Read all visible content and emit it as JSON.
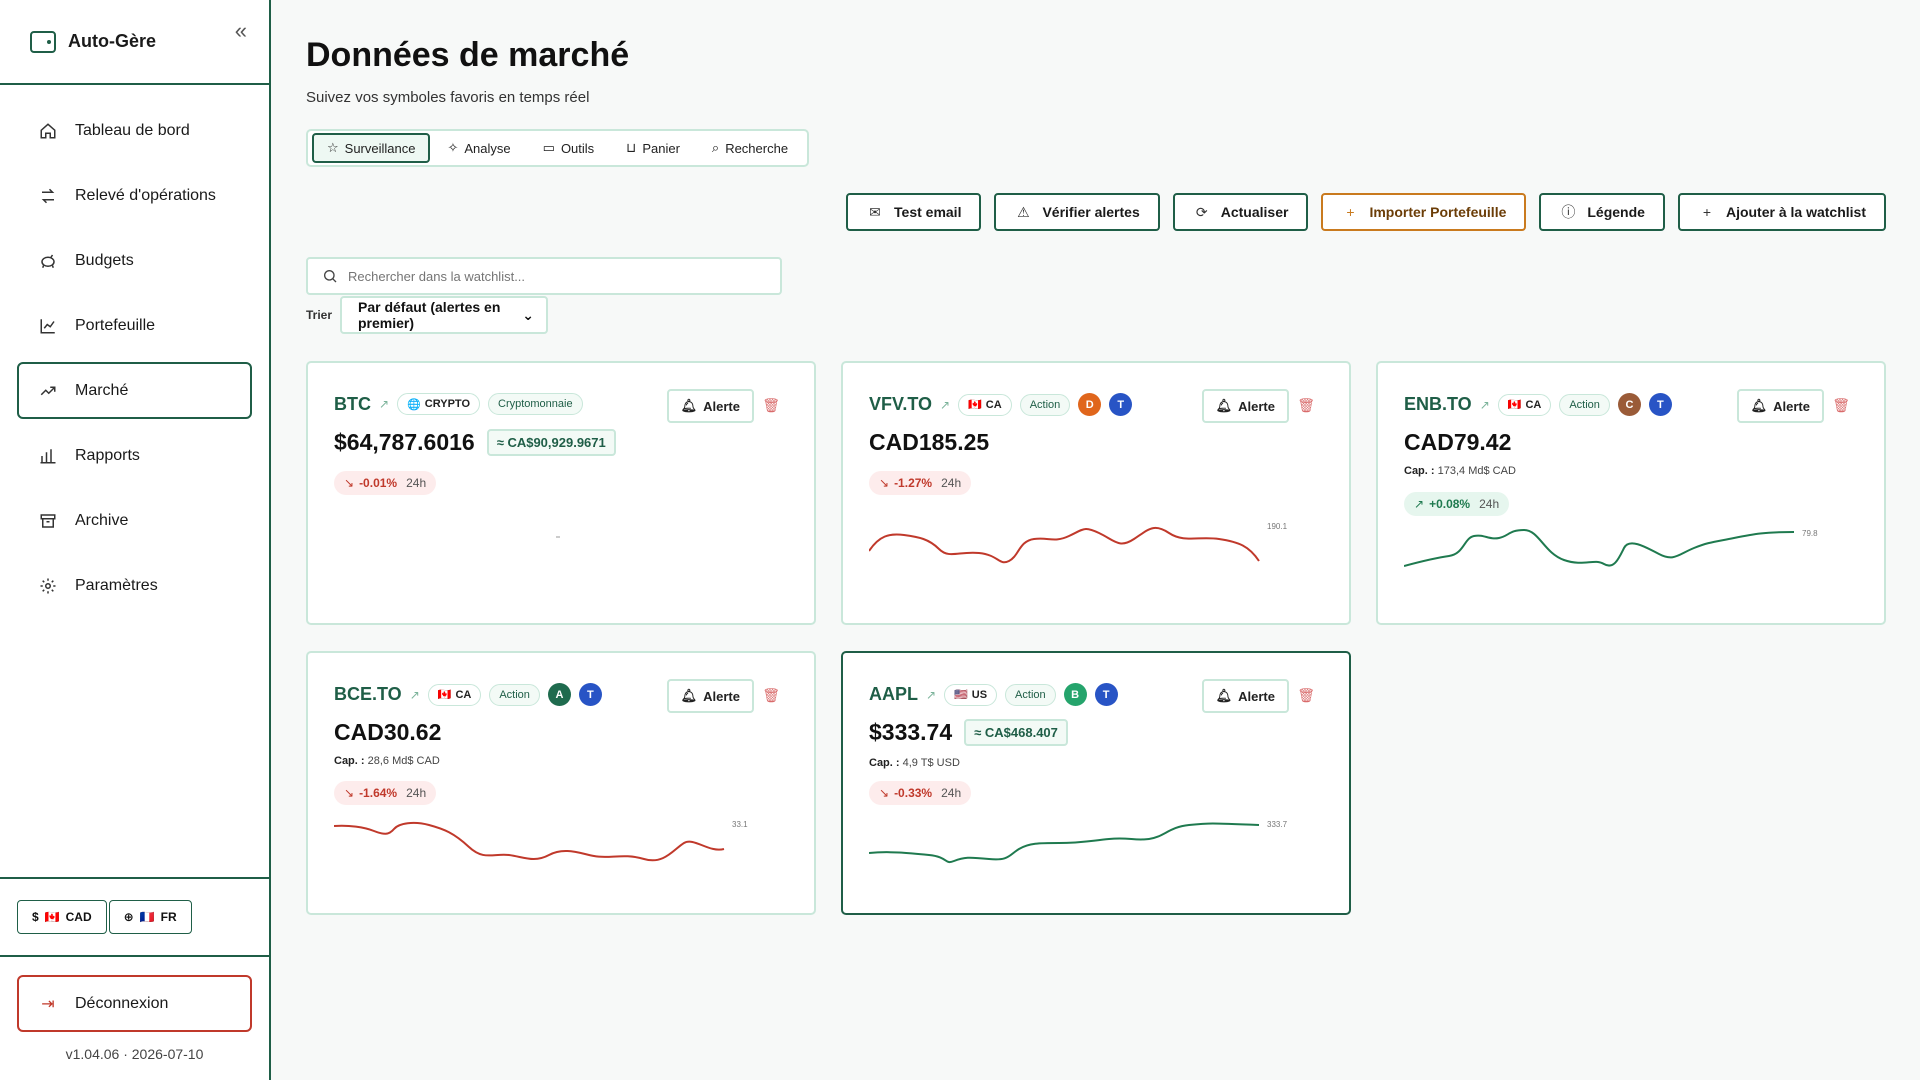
{
  "app": {
    "name": "Auto-Gère",
    "version": "v1.04.06 · 2026-07-10"
  },
  "sidebar": {
    "items": [
      {
        "label": "Tableau de bord",
        "icon": "home-icon"
      },
      {
        "label": "Relevé d'opérations",
        "icon": "transfer-icon"
      },
      {
        "label": "Budgets",
        "icon": "piggy-bank-icon"
      },
      {
        "label": "Portefeuille",
        "icon": "line-chart-icon"
      },
      {
        "label": "Marché",
        "icon": "trending-up-icon"
      },
      {
        "label": "Rapports",
        "icon": "bar-chart-icon"
      },
      {
        "label": "Archive",
        "icon": "archive-icon"
      },
      {
        "label": "Paramètres",
        "icon": "gear-icon"
      }
    ],
    "active_index": 4,
    "currency": "CAD",
    "language": "FR",
    "logout": "Déconnexion"
  },
  "header": {
    "title": "Données de marché",
    "subtitle": "Suivez vos symboles favoris en temps réel"
  },
  "tabs": [
    {
      "label": "Surveillance",
      "active": true
    },
    {
      "label": "Analyse"
    },
    {
      "label": "Outils"
    },
    {
      "label": "Panier"
    },
    {
      "label": "Recherche"
    }
  ],
  "actions": {
    "test_email": "Test email",
    "check_alerts": "Vérifier alertes",
    "refresh": "Actualiser",
    "import": "Importer Portefeuille",
    "legend": "Légende",
    "add": "Ajouter à la watchlist"
  },
  "search": {
    "placeholder": "Rechercher dans la watchlist..."
  },
  "sort": {
    "label": "Trier",
    "value": "Par défaut (alertes en premier)"
  },
  "cards": [
    {
      "ticker": "BTC",
      "region": "CRYPTO",
      "type": "Cryptomonnaie",
      "price": "$64,787.6016",
      "converted": "≈ CA$90,929.9671",
      "change": "-0.01%",
      "period": "24h",
      "direction": "down",
      "alert": "Alerte"
    },
    {
      "ticker": "VFV.TO",
      "region": "CA",
      "type": "Action",
      "price": "CAD185.25",
      "change": "-1.27%",
      "period": "24h",
      "direction": "down",
      "alert": "Alerte",
      "last_label": "190.1",
      "avatars": [
        {
          "letter": "D",
          "color": "#e0661c"
        },
        {
          "letter": "T",
          "color": "#2854c5"
        }
      ]
    },
    {
      "ticker": "ENB.TO",
      "region": "CA",
      "type": "Action",
      "price": "CAD79.42",
      "cap_label": "Cap. :",
      "cap": "173,4 Md$ CAD",
      "change": "+0.08%",
      "period": "24h",
      "direction": "up",
      "alert": "Alerte",
      "last_label": "79.8",
      "avatars": [
        {
          "letter": "C",
          "color": "#9a5b38"
        },
        {
          "letter": "T",
          "color": "#2854c5"
        }
      ]
    },
    {
      "ticker": "BCE.TO",
      "region": "CA",
      "type": "Action",
      "price": "CAD30.62",
      "cap_label": "Cap. :",
      "cap": "28,6 Md$ CAD",
      "change": "-1.64%",
      "period": "24h",
      "direction": "down",
      "alert": "Alerte",
      "last_label": "33.1",
      "avatars": [
        {
          "letter": "A",
          "color": "#1f6b4e"
        },
        {
          "letter": "T",
          "color": "#2854c5"
        }
      ]
    },
    {
      "ticker": "AAPL",
      "region": "US",
      "type": "Action",
      "price": "$333.74",
      "converted": "≈ CA$468.407",
      "cap_label": "Cap. :",
      "cap": "4,9 T$ USD",
      "change": "-0.33%",
      "period": "24h",
      "direction": "down",
      "alert": "Alerte",
      "last_label": "333.7",
      "avatars": [
        {
          "letter": "B",
          "color": "#25a46c"
        },
        {
          "letter": "T",
          "color": "#2854c5"
        }
      ]
    }
  ],
  "colors": {
    "accent": "#1f5e47",
    "border": "#c9e7da",
    "down": "#c0392b",
    "up": "#1f7a4f",
    "import": "#c97a1e"
  }
}
